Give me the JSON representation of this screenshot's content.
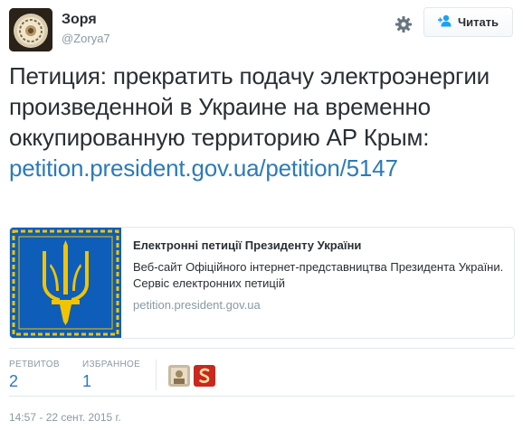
{
  "user": {
    "name": "Зоря",
    "handle": "@Zorya7"
  },
  "follow_button": {
    "label": "Читать"
  },
  "tweet": {
    "text": "Петиция: прекратить подачу электроэнергии произведенной в Украине на временно оккупированную территорию АР Крым:",
    "link": "petition.president.gov.ua/petition/5147"
  },
  "card": {
    "title": "Електронні петиції Президенту України",
    "description": "Веб-сайт Офіційного інтернет-представництва Президента України. Сервіс електронних петицій",
    "domain": "petition.president.gov.ua"
  },
  "stats": {
    "retweets_label": "РЕТВИТОВ",
    "retweets_value": "2",
    "favorites_label": "ИЗБРАННОЕ",
    "favorites_value": "1"
  },
  "timestamp": "14:57 - 22 сент. 2015 г.",
  "colors": {
    "link": "#2b7bb9",
    "muted": "#8899a6",
    "border": "#e1e8ed",
    "flag_blue": "#0e5db8",
    "trident_gold": "#f2c400"
  },
  "icons": {
    "settings": "gear-icon",
    "follow": "add-user-icon",
    "emblem": "trident-emblem"
  }
}
